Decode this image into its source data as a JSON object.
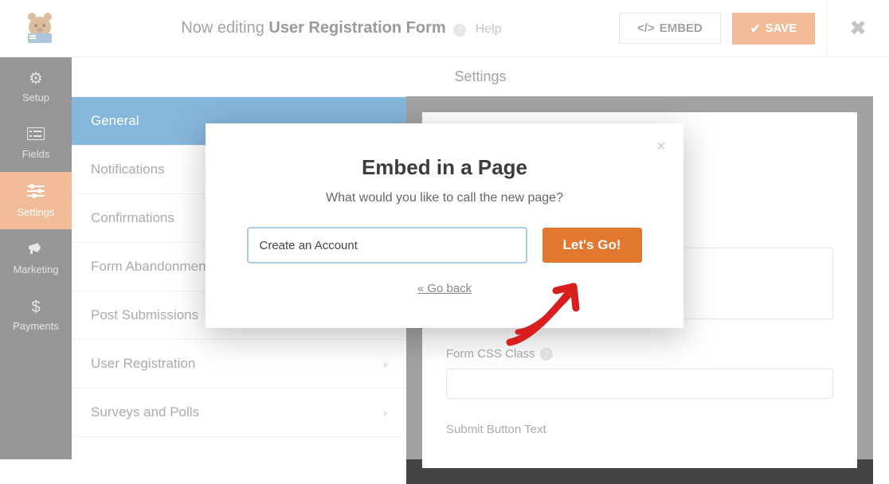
{
  "topbar": {
    "editing_prefix": "Now editing ",
    "editing_form": "User Registration Form",
    "help_text": "Help",
    "embed_label": "EMBED",
    "save_label": "SAVE"
  },
  "sidebar": [
    {
      "label": "Setup"
    },
    {
      "label": "Fields"
    },
    {
      "label": "Settings"
    },
    {
      "label": "Marketing"
    },
    {
      "label": "Payments"
    }
  ],
  "settings": {
    "header": "Settings",
    "nav": [
      {
        "label": "General",
        "selected": true,
        "expandable": false
      },
      {
        "label": "Notifications",
        "expandable": false
      },
      {
        "label": "Confirmations",
        "expandable": false
      },
      {
        "label": "Form Abandonment",
        "expandable": false
      },
      {
        "label": "Post Submissions",
        "expandable": false
      },
      {
        "label": "User Registration",
        "expandable": true
      },
      {
        "label": "Surveys and Polls",
        "expandable": true
      }
    ]
  },
  "form_panel": {
    "css_label": "Form CSS Class",
    "submit_label": "Submit Button Text"
  },
  "modal": {
    "title": "Embed in a Page",
    "subtitle": "What would you like to call the new page?",
    "input_value": "Create an Account",
    "button_label": "Let's Go!",
    "back_label": "« Go back"
  }
}
